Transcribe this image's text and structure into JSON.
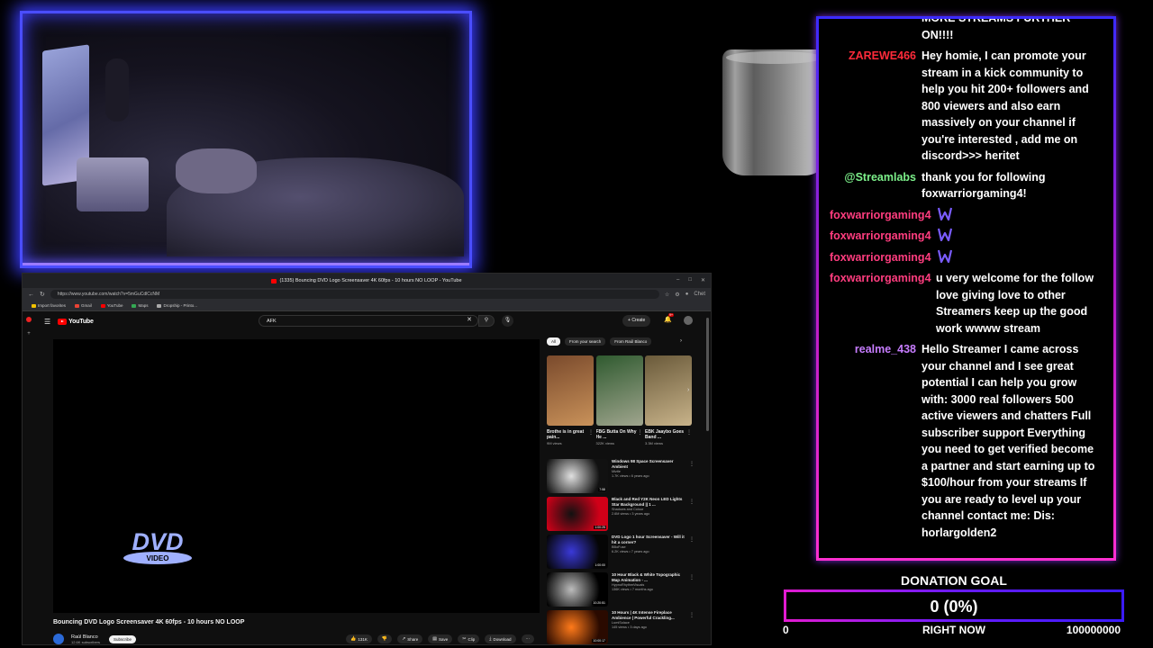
{
  "browser": {
    "tab_title": "(1335) Bouncing DVD Logo Screensaver 4K 60fps - 10 hours NO LOOP - YouTube",
    "url": "https://www.youtube.com/watch?v=5mGuCdlCcNM",
    "bookmarks": [
      {
        "label": "Import favorites",
        "color": "#f2c200"
      },
      {
        "label": "Gmail",
        "color": "#ea4335"
      },
      {
        "label": "YouTube",
        "color": "#ff0000"
      },
      {
        "label": "Maps",
        "color": "#34a853"
      },
      {
        "label": "Dropship - Printo...",
        "color": "#aaaaaa"
      }
    ],
    "profile_label": "Chet"
  },
  "youtube": {
    "logo_text": "YouTube",
    "search_value": "AFK",
    "create_label": "Create",
    "notif_count": "9+",
    "video": {
      "title": "Bouncing DVD Logo Screensaver 4K 60fps - 10 hours NO LOOP",
      "channel": "Raúl Blanco",
      "subscribers": "12.6K subscribers",
      "subscribe_label": "Subscribe",
      "likes": "131K",
      "share_label": "Share",
      "save_label": "Save",
      "clip_label": "Clip",
      "download_label": "Download",
      "logo_top": "DVD",
      "logo_bottom": "VIDEO"
    },
    "chips": [
      "All",
      "From your search",
      "From Raúl Blanco"
    ],
    "shorts": [
      {
        "title": "Brothe is in great pain...",
        "views": "9M views",
        "colors": [
          "#7a4a2c",
          "#c9925a"
        ]
      },
      {
        "title": "FBG Butta On Why He ...",
        "views": "322K views",
        "colors": [
          "#2f5a2f",
          "#a0a58e"
        ]
      },
      {
        "title": "EBK Jaaybo Goes Band ...",
        "views": "3.3M views",
        "colors": [
          "#6a5a3a",
          "#c8b38a"
        ]
      }
    ],
    "recommendations": [
      {
        "title": "Windows 98 Space Screensaver Ambient",
        "channel": "Miztle",
        "stats": "1.7K views • 6 years ago",
        "duration": "7:58",
        "colors": [
          "#111111",
          "#e0e0e0"
        ]
      },
      {
        "title": "Black and Red Y2K Neon LED Lights Star Background || 1 ...",
        "channel": "Shadows and Colour",
        "stats": "2.6M views • 3 years ago",
        "duration": "1:00:25",
        "colors": [
          "#d00018",
          "#111111"
        ]
      },
      {
        "title": "DVD Logo 1 hour Screensaver - Will it hit a corner?",
        "channel": "BBoFuse",
        "stats": "6.2K views • 7 years ago",
        "duration": "1:00:00",
        "colors": [
          "#050505",
          "#3a39d8"
        ]
      },
      {
        "title": "10 Hour Black & White Topographic Map Animation - ...",
        "channel": "HypnoRhythmVisuals",
        "stats": "136K views • 7 months ago",
        "duration": "10:20:51",
        "colors": [
          "#000000",
          "#bcbcbc"
        ]
      },
      {
        "title": "10 Hours | 4K Intense Fireplace Ambience | Powerful Crackling...",
        "channel": "LumiSolace",
        "stats": "145 views • 3 days ago",
        "duration": "10:00:17",
        "colors": [
          "#2a0a00",
          "#ff7a1a"
        ]
      }
    ]
  },
  "chat": {
    "messages": [
      {
        "user": "",
        "user_color": "#ffffff",
        "text": "TUNE IN!!!!! WILL BE DOING MORE STREAMS FURTHER ON!!!!",
        "emote_count": 0
      },
      {
        "user": "ZAREWE466",
        "user_color": "#ff2a3a",
        "text": "Hey homie, I can promote your stream in a kick community to help you hit 200+ followers and 800 viewers and also earn massively on your channel if you're interested , add me on discord>>> heritet",
        "emote_count": 0
      },
      {
        "user": "@Streamlabs",
        "user_color": "#7cf08a",
        "text": "thank you for following foxwarriorgaming4!",
        "emote_count": 0
      },
      {
        "user": "foxwarriorgaming4",
        "user_color": "#ff3d7f",
        "text": "",
        "emote_count": 1
      },
      {
        "user": "foxwarriorgaming4",
        "user_color": "#ff3d7f",
        "text": "",
        "emote_count": 1
      },
      {
        "user": "foxwarriorgaming4",
        "user_color": "#ff3d7f",
        "text": "",
        "emote_count": 1
      },
      {
        "user": "foxwarriorgaming4",
        "user_color": "#ff3d7f",
        "text": "u very welcome for the follow love giving love to other Streamers keep up the good work wwww stream",
        "emote_count": 0
      },
      {
        "user": "realme_438",
        "user_color": "#c77dff",
        "text": "Hello Streamer I came across your channel and I see great potential I can help you grow with: 3000 real followers 500 active viewers and chatters Full subscriber support Everything you need to get verified become a partner and start earning up to $100/hour from your streams If you are ready to level up your channel contact me: Dis: horlargolden2",
        "emote_count": 0
      }
    ],
    "emote_color": "#7a5cff"
  },
  "donation": {
    "title": "DONATION GOAL",
    "current_display": "0 (0%)",
    "progress_fraction": 0,
    "min_label": "0",
    "status_label": "RIGHT NOW",
    "max_label": "100000000",
    "fill_color": "#ff00ff"
  }
}
